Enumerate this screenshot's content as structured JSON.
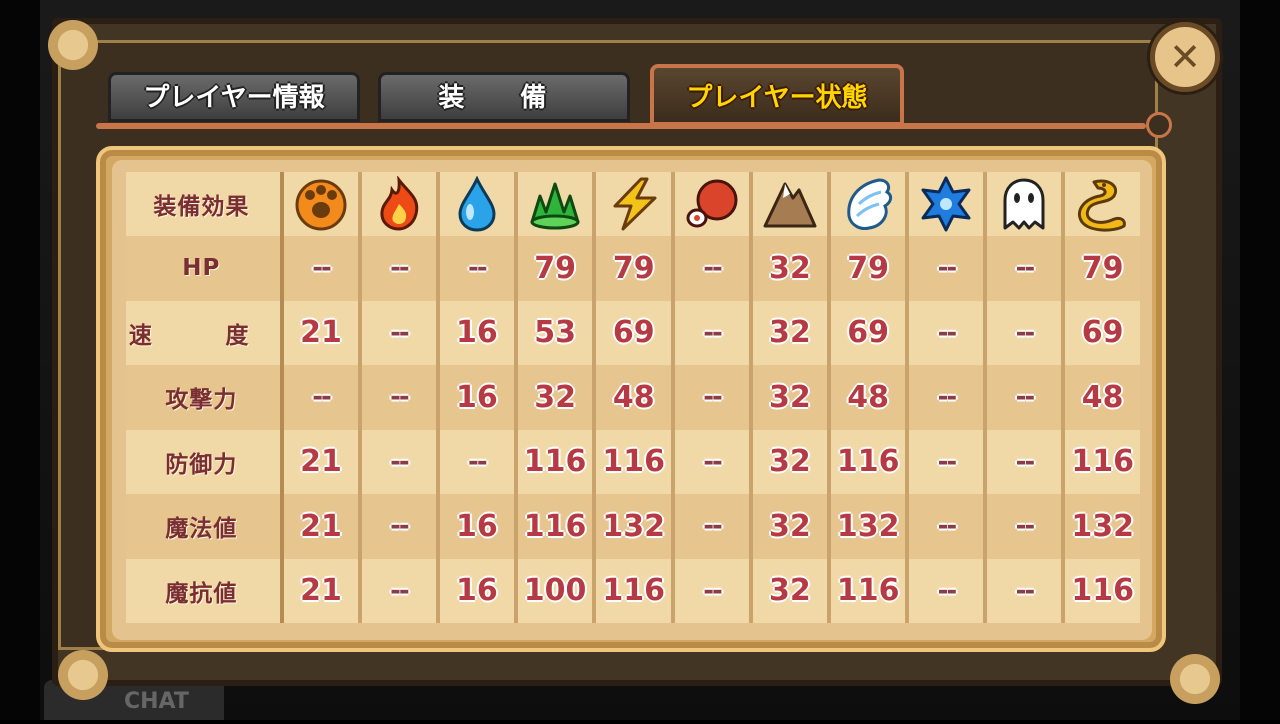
{
  "tabs": {
    "player_info": "プレイヤー情報",
    "equipment": "装 備",
    "player_status": "プレイヤー状態"
  },
  "close_label": "✕",
  "chat_label": "CHAT",
  "table": {
    "header_label": "装備効果",
    "icons": [
      {
        "name": "paw-icon",
        "color": "#f28a1c"
      },
      {
        "name": "fire-icon",
        "color": "#ee4a15"
      },
      {
        "name": "water-drop-icon",
        "color": "#2aa3e8"
      },
      {
        "name": "grass-icon",
        "color": "#2fb33a"
      },
      {
        "name": "lightning-icon",
        "color": "#f2c318"
      },
      {
        "name": "meat-icon",
        "color": "#d9442a"
      },
      {
        "name": "mountain-icon",
        "color": "#a67c52"
      },
      {
        "name": "wing-icon",
        "color": "#7cc3f2"
      },
      {
        "name": "star-icon",
        "color": "#1f7de0"
      },
      {
        "name": "ghost-icon",
        "color": "#ffffff"
      },
      {
        "name": "dragon-icon",
        "color": "#f2b818"
      }
    ],
    "rows": [
      {
        "label": "HP",
        "values": [
          "--",
          "--",
          "--",
          "79",
          "79",
          "--",
          "32",
          "79",
          "--",
          "--",
          "79"
        ]
      },
      {
        "label": "速　度",
        "values": [
          "21",
          "--",
          "16",
          "53",
          "69",
          "--",
          "32",
          "69",
          "--",
          "--",
          "69"
        ]
      },
      {
        "label": "攻撃力",
        "values": [
          "--",
          "--",
          "16",
          "32",
          "48",
          "--",
          "32",
          "48",
          "--",
          "--",
          "48"
        ]
      },
      {
        "label": "防御力",
        "values": [
          "21",
          "--",
          "--",
          "116",
          "116",
          "--",
          "32",
          "116",
          "--",
          "--",
          "116"
        ]
      },
      {
        "label": "魔法値",
        "values": [
          "21",
          "--",
          "16",
          "116",
          "132",
          "--",
          "32",
          "132",
          "--",
          "--",
          "132"
        ]
      },
      {
        "label": "魔抗値",
        "values": [
          "21",
          "--",
          "16",
          "100",
          "116",
          "--",
          "32",
          "116",
          "--",
          "--",
          "116"
        ]
      }
    ]
  }
}
